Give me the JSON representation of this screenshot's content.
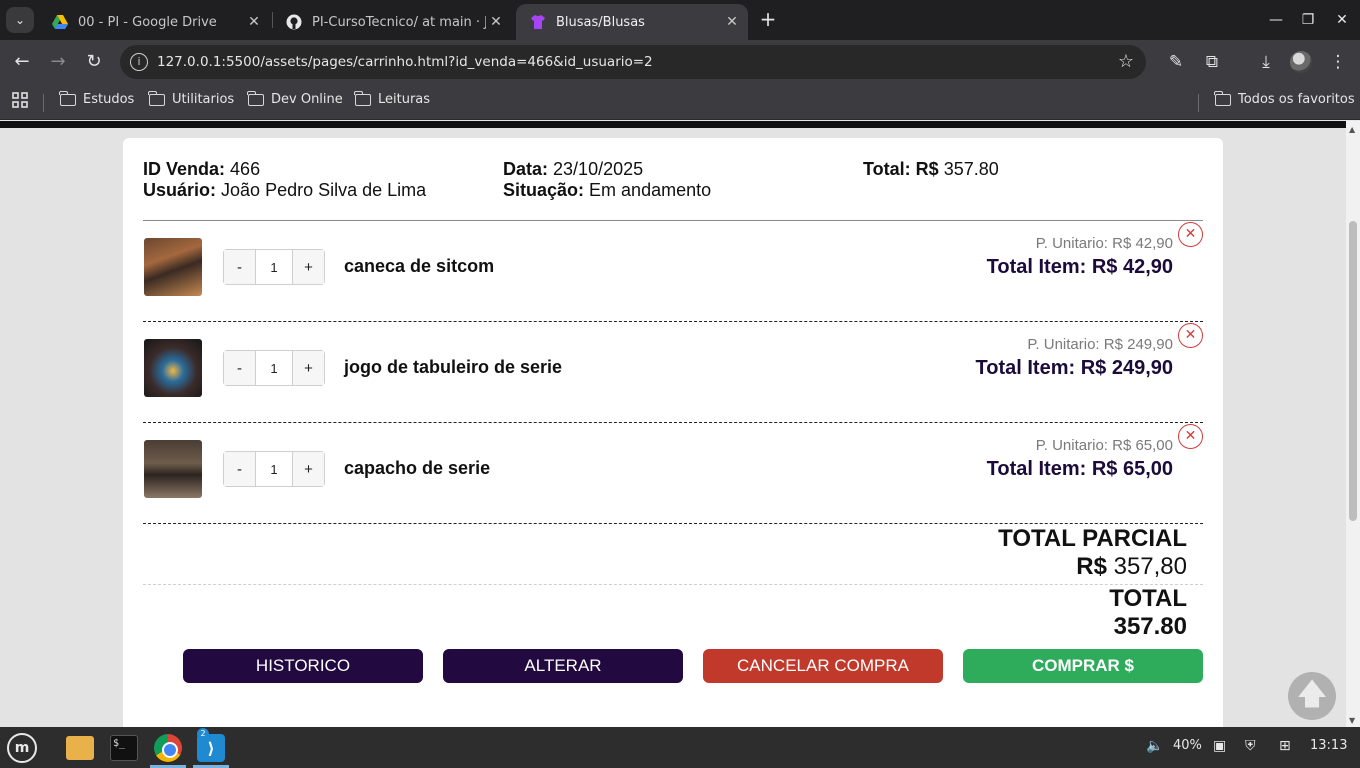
{
  "browser": {
    "tabs": [
      {
        "title": "00 - PI - Google Drive",
        "icon": "google-drive-icon",
        "active": false
      },
      {
        "title": "PI-CursoTecnico/ at main · Jo",
        "icon": "github-icon",
        "active": false
      },
      {
        "title": "Blusas/Blusas",
        "icon": "shirt-icon",
        "active": true
      }
    ],
    "url": "127.0.0.1:5500/assets/pages/carrinho.html?id_venda=466&id_usuario=2",
    "bookmarks": [
      "Estudos",
      "Utilitarios",
      "Dev Online",
      "Leituras"
    ],
    "all_bookmarks": "Todos os favoritos"
  },
  "sale": {
    "id_label": "ID Venda:",
    "id_value": "466",
    "user_label": "Usuário:",
    "user_value": "João Pedro Silva de Lima",
    "date_label": "Data:",
    "date_value": "23/10/2025",
    "status_label": "Situação:",
    "status_value": "Em andamento",
    "total_label": "Total: R$",
    "total_value": "357.80"
  },
  "items": [
    {
      "name": "caneca de sitcom",
      "qty": "1",
      "unit_price": "P. Unitario: R$ 42,90",
      "total": "Total Item: R$ 42,90"
    },
    {
      "name": "jogo de tabuleiro de serie",
      "qty": "1",
      "unit_price": "P. Unitario: R$ 249,90",
      "total": "Total Item: R$ 249,90"
    },
    {
      "name": "capacho de serie",
      "qty": "1",
      "unit_price": "P. Unitario: R$ 65,00",
      "total": "Total Item: R$ 65,00"
    }
  ],
  "qty_controls": {
    "minus": "-",
    "plus": "+"
  },
  "totals": {
    "partial_label": "TOTAL PARCIAL",
    "partial_currency": "R$",
    "partial_value": "357,80",
    "total_label": "TOTAL",
    "total_value": "357.80"
  },
  "actions": {
    "history": "HISTORICO",
    "alter": "ALTERAR",
    "cancel": "CANCELAR COMPRA",
    "buy": "COMPRAR $"
  },
  "colors": {
    "dark_button": "#22093f",
    "cancel_button": "#c0392b",
    "buy_button": "#2eac5c",
    "remove_icon": "#d33a3a"
  },
  "taskbar": {
    "battery": "40%",
    "clock": "13:13",
    "vscode_badge": "2"
  }
}
